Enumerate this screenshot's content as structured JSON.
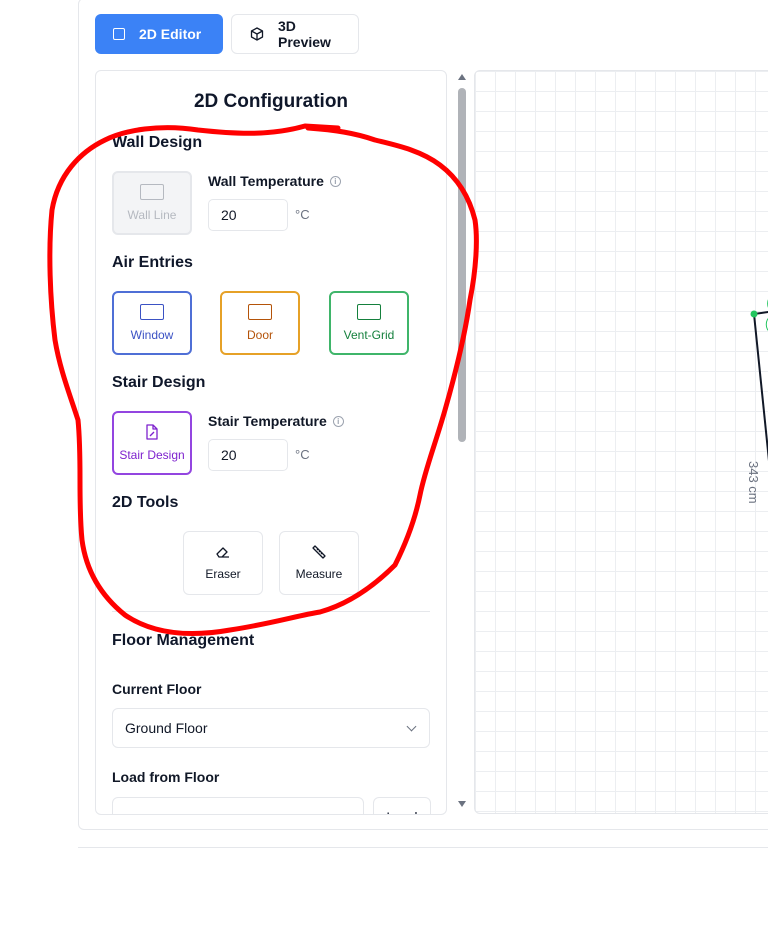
{
  "tabs": [
    {
      "label": "2D Editor",
      "icon": "square-icon",
      "active": true
    },
    {
      "label": "3D Preview",
      "icon": "cube-icon",
      "active": false
    }
  ],
  "panel": {
    "title": "2D Configuration",
    "wall_design": {
      "title": "Wall Design",
      "wall_line_label": "Wall Line",
      "temperature_label": "Wall Temperature",
      "temperature_value": "20",
      "unit": "°C"
    },
    "air_entries": {
      "title": "Air Entries",
      "window_label": "Window",
      "door_label": "Door",
      "vent_label": "Vent-Grid"
    },
    "stair_design": {
      "title": "Stair Design",
      "button_label": "Stair Design",
      "temperature_label": "Stair Temperature",
      "temperature_value": "20",
      "unit": "°C"
    },
    "tools": {
      "title": "2D Tools",
      "eraser_label": "Eraser",
      "measure_label": "Measure"
    },
    "floor_management": {
      "title": "Floor Management",
      "current_floor_label": "Current Floor",
      "current_floor_value": "Ground Floor",
      "load_from_label": "Load from Floor",
      "load_button": "Load"
    }
  },
  "canvas": {
    "measurement_label": "343 cm"
  },
  "colors": {
    "accent": "#3b82f6",
    "window": "#3b52c4",
    "door": "#b45309",
    "vent": "#15803d",
    "stair": "#7e22ce",
    "annotation": "#ff0000"
  }
}
